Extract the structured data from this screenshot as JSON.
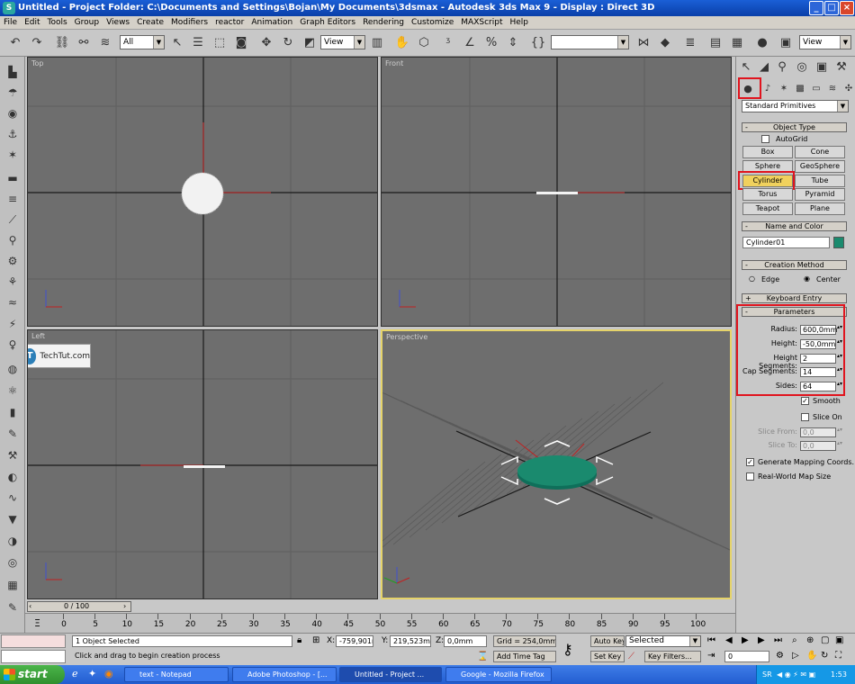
{
  "window": {
    "title": "Untitled     - Project Folder: C:\\Documents and Settings\\Bojan\\My Documents\\3dsmax     - Autodesk 3ds Max 9     - Display : Direct 3D",
    "app_icon": "3dsmax-icon",
    "controls": [
      "minimize",
      "maximize",
      "close"
    ]
  },
  "menu": [
    "File",
    "Edit",
    "Tools",
    "Group",
    "Views",
    "Create",
    "Modifiers",
    "reactor",
    "Animation",
    "Graph Editors",
    "Rendering",
    "Customize",
    "MAXScript",
    "Help"
  ],
  "toolbar": {
    "selection_filter": "All",
    "ref_coord": "View",
    "named_selection": "",
    "render_view": "View"
  },
  "viewports": {
    "top": {
      "label": "Top"
    },
    "front": {
      "label": "Front"
    },
    "left": {
      "label": "Left"
    },
    "perspective": {
      "label": "Perspective"
    }
  },
  "watermark": {
    "text": "TechTut.com",
    "letter": "T"
  },
  "command_panel": {
    "category": "Standard Primitives",
    "object_type": {
      "header": "Object Type",
      "autogrid": "AutoGrid",
      "buttons": [
        "Box",
        "Cone",
        "Sphere",
        "GeoSphere",
        "Cylinder",
        "Tube",
        "Torus",
        "Pyramid",
        "Teapot",
        "Plane"
      ],
      "selected": "Cylinder"
    },
    "name_and_color": {
      "header": "Name and Color",
      "name": "Cylinder01",
      "color": "#1a8a6e"
    },
    "creation_method": {
      "header": "Creation Method",
      "options": [
        "Edge",
        "Center"
      ],
      "selected": "Center"
    },
    "keyboard_entry": {
      "header": "Keyboard Entry"
    },
    "parameters": {
      "header": "Parameters",
      "radius_label": "Radius:",
      "radius": "600,0mm",
      "height_label": "Height:",
      "height": "-50,0mm",
      "height_segments_label": "Height Segments:",
      "height_segments": "2",
      "cap_segments_label": "Cap Segments:",
      "cap_segments": "14",
      "sides_label": "Sides:",
      "sides": "64",
      "smooth": "Smooth",
      "slice_on": "Slice On",
      "slice_from_label": "Slice From:",
      "slice_from": "0,0",
      "slice_to_label": "Slice To:",
      "slice_to": "0,0",
      "gen_mapping": "Generate Mapping Coords.",
      "real_world": "Real-World Map Size"
    }
  },
  "timeline": {
    "frame": "0 / 100",
    "ticks": [
      "0",
      "5",
      "10",
      "15",
      "20",
      "25",
      "30",
      "35",
      "40",
      "45",
      "50",
      "55",
      "60",
      "65",
      "70",
      "75",
      "80",
      "85",
      "90",
      "95",
      "100"
    ]
  },
  "status": {
    "selected": "1 Object Selected",
    "prompt": "Click and drag to begin creation process",
    "x_label": "X:",
    "x": "-759,901mi",
    "y_label": "Y:",
    "y": "219,523mi",
    "z_label": "Z:",
    "z": "0,0mm",
    "grid": "Grid = 254,0mm",
    "add_time_tag": "Add Time Tag",
    "auto_key": "Auto Key",
    "set_key": "Set Key",
    "key_mode": "Selected",
    "key_filters": "Key Filters...",
    "current_frame": "0"
  },
  "taskbar": {
    "start": "start",
    "tasks": [
      "text - Notepad",
      "Adobe Photoshop - [...",
      "Untitled     - Project ...",
      "Google - Mozilla Firefox"
    ],
    "lang": "SR",
    "clock": "1:53"
  }
}
